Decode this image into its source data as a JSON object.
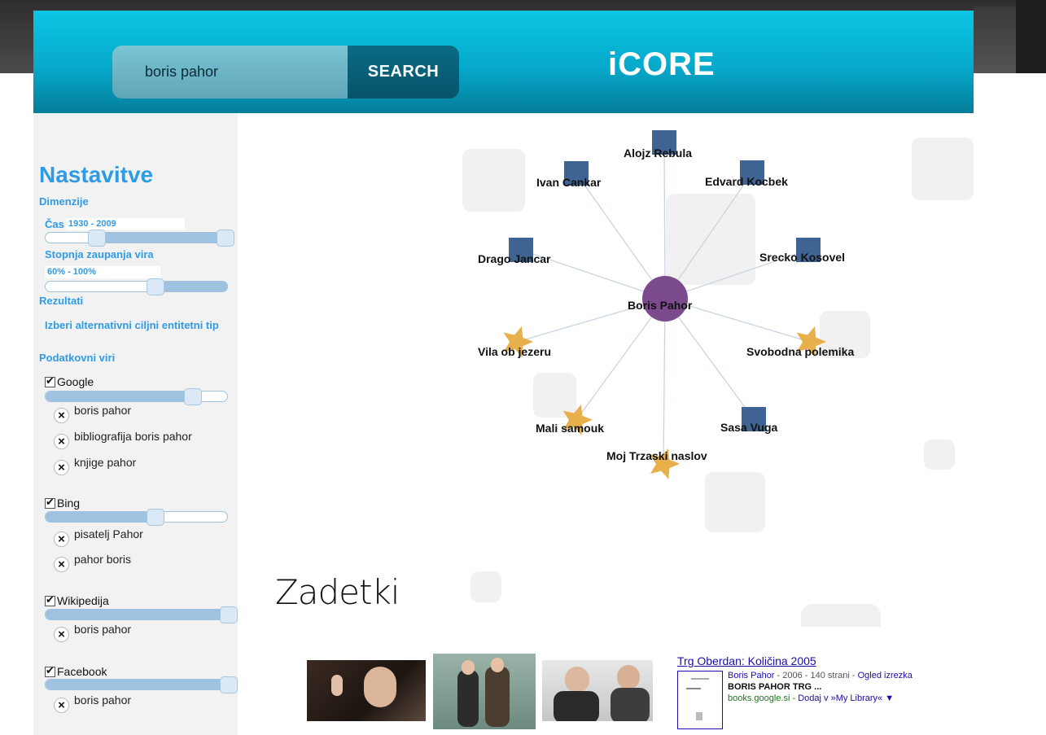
{
  "header": {
    "search_value": "boris pahor",
    "search_button": "SEARCH",
    "logo": "iCORE"
  },
  "sidebar": {
    "title": "Nastavitve",
    "dimensions_label": "Dimenzije",
    "time_label": "Čas",
    "time_range": "1930 - 2009",
    "trust_label": "Stopnja zaupanja vira",
    "trust_range": "60% - 100%",
    "results_label": "Rezultati",
    "alt_entity_label": "Izberi alternativni ciljni entitetni tip",
    "sources_label": "Podatkovni viri",
    "sources": [
      {
        "name": "Google",
        "weight": 0.82,
        "queries": [
          "boris pahor",
          "bibliografija boris pahor",
          "knjige pahor"
        ]
      },
      {
        "name": "Bing",
        "weight": 0.55,
        "queries": [
          "pisatelj Pahor",
          "pahor boris"
        ]
      },
      {
        "name": "Wikipedija",
        "weight": 1.0,
        "queries": [
          "boris pahor"
        ]
      },
      {
        "name": "Facebook",
        "weight": 1.0,
        "queries": [
          "boris pahor"
        ]
      }
    ]
  },
  "graph": {
    "center": "Boris Pahor",
    "center_color": "#7b4b8e",
    "person_color": "#3f6393",
    "work_color": "#e8b04a",
    "people": [
      "Alojz Rebula",
      "Ivan Cankar",
      "Edvard Kocbek",
      "Drago Jancar",
      "Srecko Kosovel",
      "Sasa Vuga"
    ],
    "works": [
      "Vila ob jezeru",
      "Svobodna polemika",
      "Mali samouk",
      "Moj Trzaski naslov"
    ]
  },
  "results": {
    "title": "Zadetki",
    "book": {
      "title": "Trg Oberdan: Količina 2005",
      "meta_author": "Boris Pahor",
      "meta_rest": " - 2006 - 140 strani - ",
      "meta_preview": "Ogled izrezka",
      "snippet": "BORIS PAHOR TRG ...",
      "source": "books.google.si",
      "add_link": "Dodaj v »My Library« ▼"
    }
  }
}
